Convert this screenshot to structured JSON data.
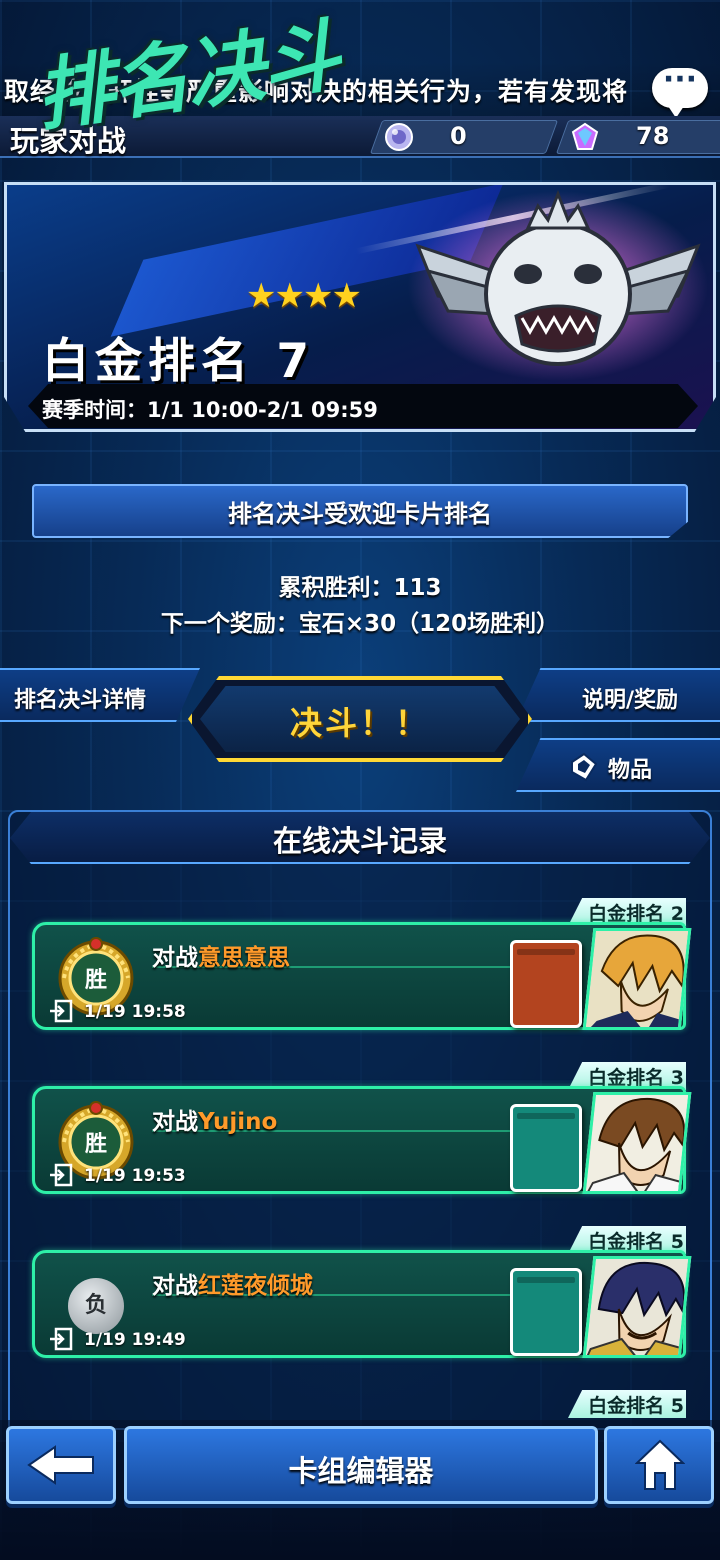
{
  "notice": {
    "text": "取经验、开挂等严重影响对决的相关行为，若有发现将"
  },
  "header": {
    "title": "玩家对战",
    "currency": [
      {
        "icon": "orb-icon",
        "value": "0"
      },
      {
        "icon": "gem-icon",
        "value": "78"
      }
    ]
  },
  "banner": {
    "mode_title": "排名决斗",
    "stars": "★★★★",
    "rank": "白金排名 7",
    "season": "赛季时间：1/1 10:00-2/1 09:59"
  },
  "popular_cards_label": "排名决斗受欢迎卡片排名",
  "stats": {
    "wins": "累积胜利：113",
    "next_reward": "下一个奖励：宝石×30（120场胜利）"
  },
  "tabs": {
    "details": "排名决斗详情",
    "duel": "决斗！！",
    "help": "说明/奖励",
    "items": "物品"
  },
  "log": {
    "title": "在线决斗记录",
    "records": [
      {
        "rank": "白金排名 2",
        "result": "胜",
        "prefix": "对战",
        "opponent": "意思意思",
        "time": "1/19 19:58",
        "deck_color": "#b3441f"
      },
      {
        "rank": "白金排名 3",
        "result": "胜",
        "prefix": "对战",
        "opponent": "Yujino",
        "time": "1/19 19:53",
        "deck_color": "#14897a"
      },
      {
        "rank": "白金排名 5",
        "result": "负",
        "prefix": "对战",
        "opponent": "红莲夜倾城",
        "time": "1/19 19:49",
        "deck_color": "#14897a"
      },
      {
        "rank": "白金排名 5"
      }
    ]
  },
  "bottom": {
    "deck_editor": "卡组编辑器"
  },
  "colors": {
    "accent": "#2ef0a8",
    "gold": "#ffd835",
    "opponent_name": "#ff9a2a"
  }
}
